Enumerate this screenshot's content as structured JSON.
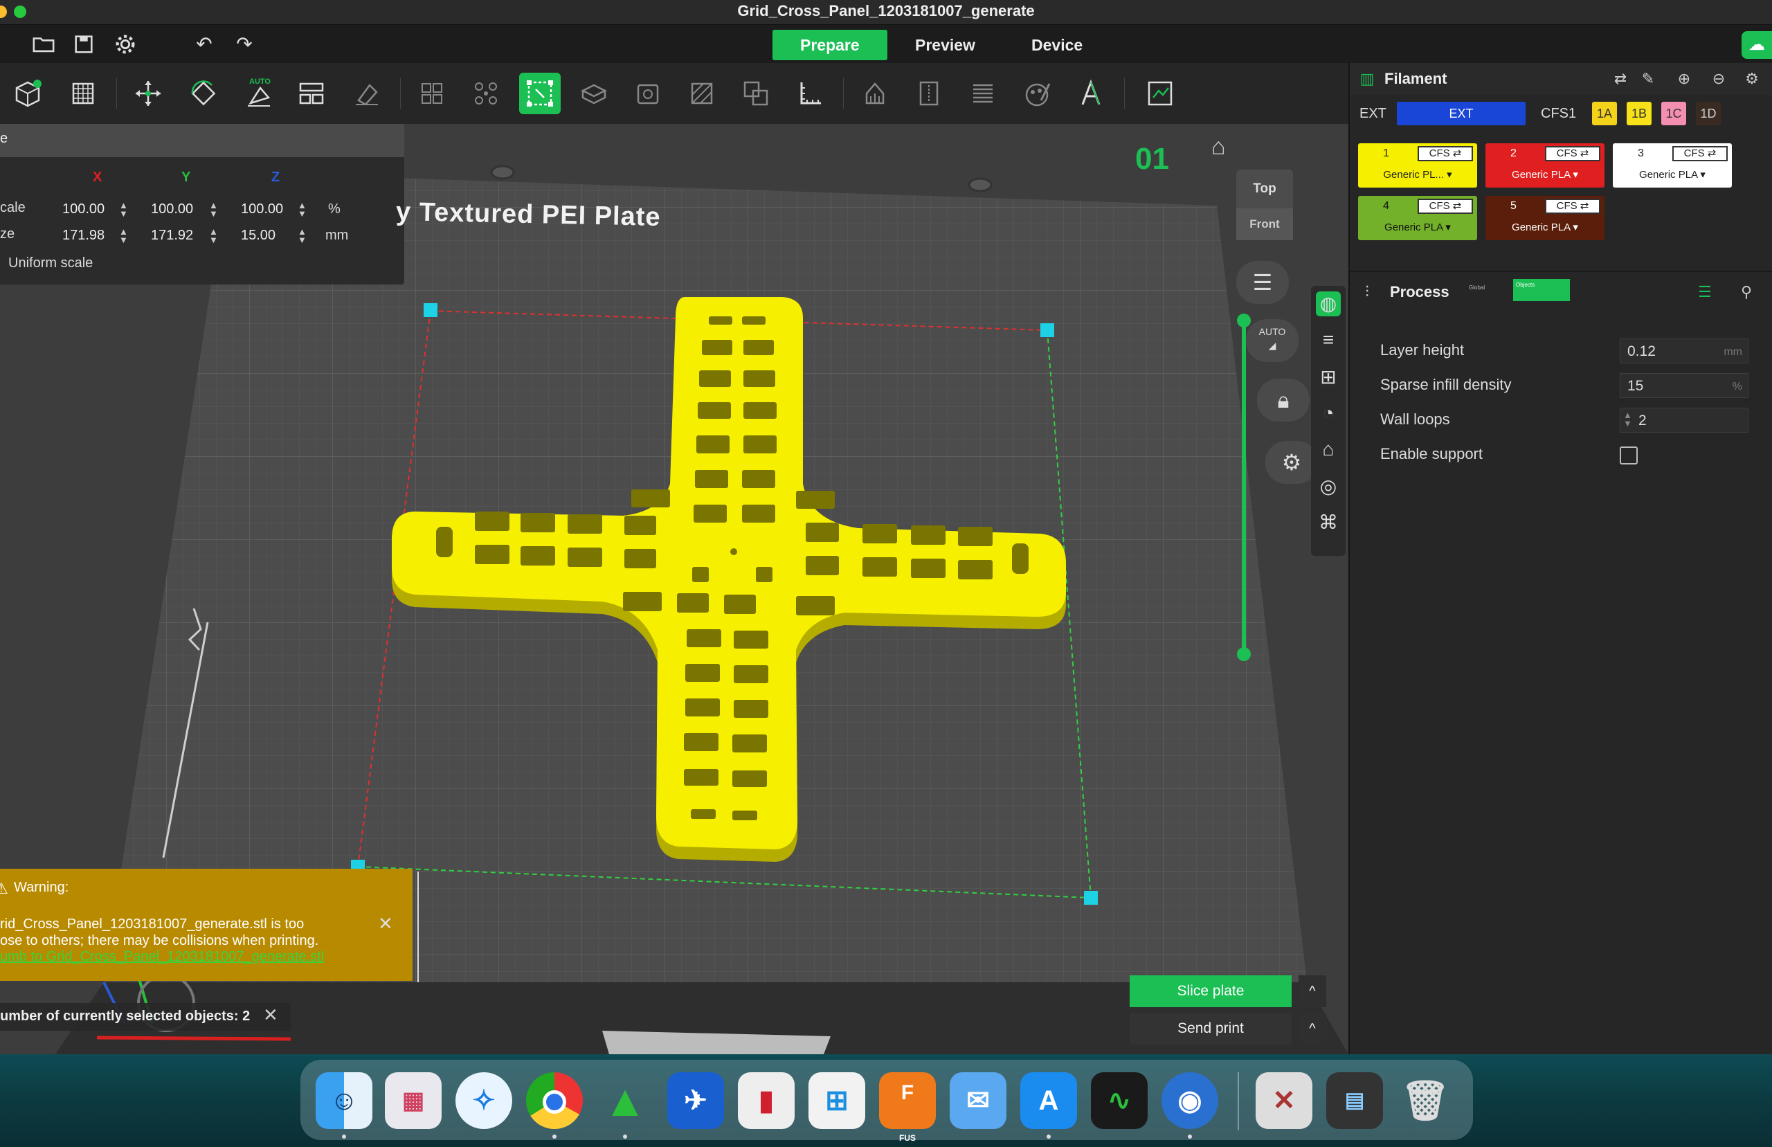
{
  "window": {
    "title": "Grid_Cross_Panel_1203181007_generate"
  },
  "menubar": {
    "tabs": [
      {
        "label": "Prepare",
        "active": true
      },
      {
        "label": "Preview",
        "active": false
      },
      {
        "label": "Device",
        "active": false
      }
    ],
    "icons": [
      "folder-icon",
      "save-icon",
      "settings-icon",
      "undo-icon",
      "redo-icon",
      "cloud-upload-icon"
    ]
  },
  "toolbar": {
    "tools": [
      "add-object-icon",
      "arrange-grid-icon",
      "move-icon",
      "rotate-icon",
      "auto-orient-icon",
      "layout-icon",
      "place-on-face-icon",
      "split-objects-icon",
      "split-parts-icon",
      "scale-icon",
      "cut-icon",
      "hollow-icon",
      "variable-layer-icon",
      "boolean-icon",
      "measure-icon",
      "support-paint-icon",
      "seam-paint-icon",
      "fuzzy-skin-icon",
      "color-paint-icon",
      "text-icon",
      "assembly-view-icon"
    ],
    "auto_label": "AUTO",
    "active_tool": "scale-icon"
  },
  "scale_panel": {
    "axis_x": "X",
    "axis_y": "Y",
    "axis_z": "Z",
    "scale_label": "cale",
    "size_label": "ze",
    "scale_x": "100.00",
    "scale_y": "100.00",
    "scale_z": "100.00",
    "scale_unit": "%",
    "size_x": "171.98",
    "size_y": "171.92",
    "size_z": "15.00",
    "size_unit": "mm",
    "uniform_label": "Uniform scale",
    "header_fragment": "e"
  },
  "viewport": {
    "plate_label": "y Textured PEI Plate",
    "plate_number": "01",
    "view_top": "Top",
    "view_front": "Front",
    "auto_label": "AUTO",
    "object_color": "#f6f000",
    "accent": "#1bbf54"
  },
  "warning": {
    "title": "Warning:",
    "line1": "rid_Cross_Panel_1203181007_generate.stl is too",
    "line2": "ose to others; there may be collisions when printing.",
    "link": "umb to Grid_Cross_Panel_1203181007_generate.stl"
  },
  "selection": {
    "text": "umber of currently selected objects: 2"
  },
  "actions": {
    "slice": "Slice plate",
    "send": "Send print",
    "caret": "^"
  },
  "filament": {
    "title": "Filament",
    "ext_label": "EXT",
    "ext_chip": "EXT",
    "cfs_label": "CFS1",
    "cfs_slots": [
      {
        "label": "1A",
        "color": "#f5d21a"
      },
      {
        "label": "1B",
        "color": "#f7e21a"
      },
      {
        "label": "1C",
        "color": "#f48fb1"
      },
      {
        "label": "1D",
        "color": "#3a2b22"
      }
    ],
    "cards": [
      {
        "num": "1",
        "cfs": "CFS ⇄",
        "name": "Generic PL... ▾",
        "color": "#f6f000",
        "text": "#222"
      },
      {
        "num": "2",
        "cfs": "CFS ⇄",
        "name": "Generic PLA ▾",
        "color": "#e02020",
        "text": "#fff"
      },
      {
        "num": "3",
        "cfs": "CFS ⇄",
        "name": "Generic PLA ▾",
        "color": "#ffffff",
        "text": "#222"
      },
      {
        "num": "4",
        "cfs": "CFS ⇄",
        "name": "Generic PLA ▾",
        "color": "#74b12a",
        "text": "#111"
      },
      {
        "num": "5",
        "cfs": "CFS ⇄",
        "name": "Generic PLA ▾",
        "color": "#5a1e0a",
        "text": "#fff"
      }
    ]
  },
  "process": {
    "title": "Process",
    "global_label": "Global",
    "objects_label": "Objects",
    "params": [
      {
        "label": "Layer height",
        "value": "0.12",
        "unit": "mm"
      },
      {
        "label": "Sparse infill density",
        "value": "15",
        "unit": "%"
      },
      {
        "label": "Wall loops",
        "value": "2",
        "unit": ""
      },
      {
        "label": "Enable support",
        "value": "",
        "unit": ""
      }
    ]
  },
  "dock": {
    "apps": [
      "finder-icon",
      "launchpad-icon",
      "safari-icon",
      "chrome-icon",
      "creality-print-icon",
      "xcode-icon",
      "parallels-icon",
      "windows-app-icon",
      "fusion-icon",
      "mail-icon",
      "app-store-icon",
      "activity-monitor-icon",
      "scroll-app-icon",
      "thumbnail-icon",
      "preview-window-icon",
      "trash-icon"
    ],
    "fusion_label": "FUS"
  }
}
